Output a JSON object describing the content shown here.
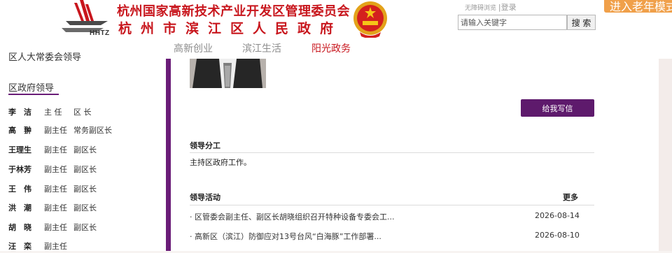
{
  "header": {
    "logo_text": "HHTZ",
    "title_line1": "杭州国家高新技术产业开发区管理委员会",
    "title_line2": "杭州市滨江区人民政府",
    "nav": [
      "高新创业",
      "滨江生活",
      "阳光政务"
    ],
    "nav_active": "阳光政务",
    "accessibility_link": "无障碍浏览",
    "login_link": "|登录",
    "search_placeholder": "请输入关键字",
    "search_button": "搜 索",
    "elder_mode": "进入老年模式"
  },
  "sidebar": {
    "cut_heading": "区人大常委会领导",
    "heading": "区政府领导",
    "leaders": [
      {
        "name": "李　洁",
        "title": "主 任",
        "role": "区 长"
      },
      {
        "name": "高　翀",
        "title": "副主任",
        "role": "常务副区长"
      },
      {
        "name": "王理生",
        "title": "副主任",
        "role": "副区长"
      },
      {
        "name": "于林芳",
        "title": "副主任",
        "role": "副区长"
      },
      {
        "name": "王　伟",
        "title": "副主任",
        "role": "副区长"
      },
      {
        "name": "洪　潮",
        "title": "副主任",
        "role": "副区长"
      },
      {
        "name": "胡　晓",
        "title": "副主任",
        "role": "副区长"
      },
      {
        "name": "汪　栾",
        "title": "副主任",
        "role": ""
      }
    ]
  },
  "main": {
    "write_button": "给我写信",
    "duties_title": "领导分工",
    "duties_text": "主持区政府工作。",
    "activities_title": "领导活动",
    "more_link": "更多",
    "activities": [
      {
        "title": "· 区管委会副主任、副区长胡晓组织召开特种设备专委会工...",
        "date": "2026-08-14"
      },
      {
        "title": "· 高新区（滨江）防御应对13号台风“白海豚”工作部署...",
        "date": "2026-08-10"
      }
    ]
  },
  "colors": {
    "brand_red": "#c8161d",
    "purple": "#6a1d78",
    "button_purple": "#5e1a6c",
    "elder_orange": "#f0a04a"
  }
}
